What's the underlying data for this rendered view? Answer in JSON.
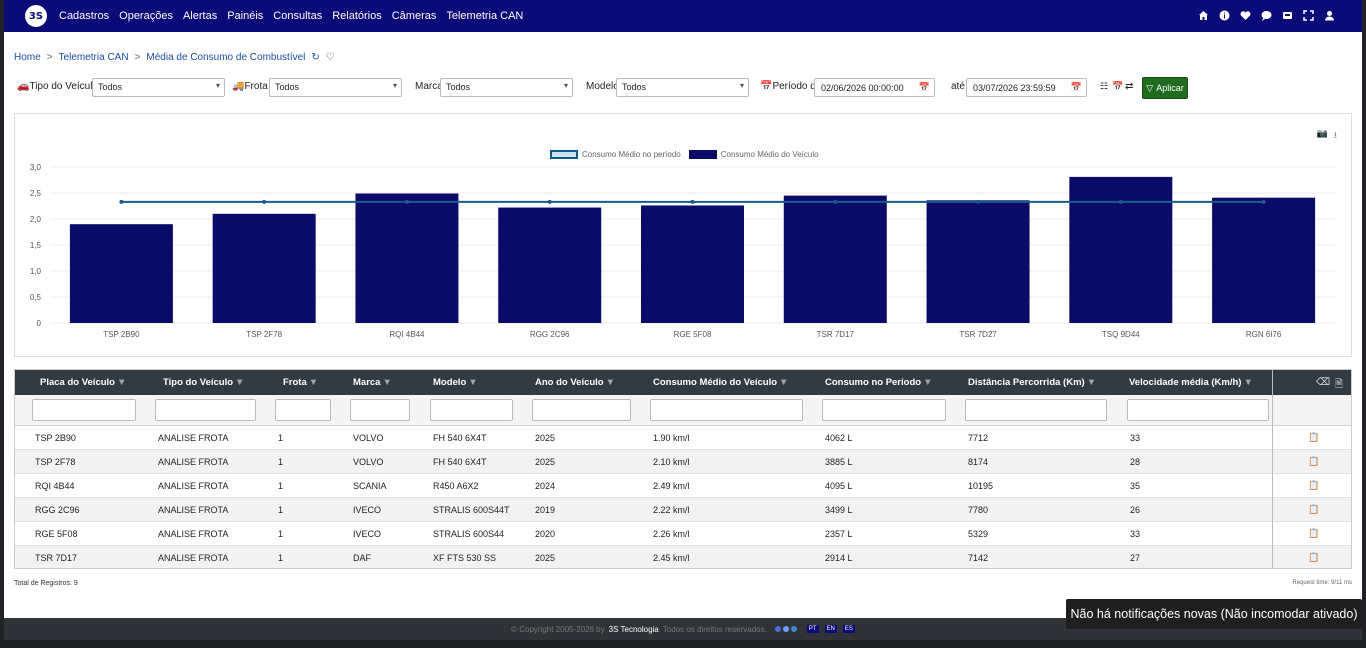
{
  "nav": {
    "menu": [
      "Cadastros",
      "Operações",
      "Alertas",
      "Painéis",
      "Consultas",
      "Relatórios",
      "Câmeras",
      "Telemetria CAN"
    ],
    "icons": [
      "home-icon",
      "info-icon",
      "heart-icon",
      "chat-icon",
      "inbox-icon",
      "fullscreen-icon",
      "user-icon"
    ]
  },
  "breadcrumb": {
    "home": "Home",
    "section": "Telemetria CAN",
    "page": "Média de Consumo de Combustível"
  },
  "filters": {
    "tipo_label": "Tipo do Veículo",
    "tipo_value": "Todos",
    "frota_label": "Frota",
    "frota_value": "Todos",
    "marca_label": "Marca",
    "marca_value": "Todos",
    "modelo_label": "Modelo",
    "modelo_value": "Todos",
    "periodo_label": "Período de",
    "periodo_start": "02/06/2026 00:00:00",
    "ate_label": "até",
    "periodo_end": "03/07/2026 23:59:59",
    "apply_label": "Aplicar"
  },
  "chart_data": {
    "type": "bar",
    "categories": [
      "TSP 2B90",
      "TSP 2F78",
      "RQI 4B44",
      "RGG 2C96",
      "RGE 5F08",
      "TSR 7D17",
      "TSR 7D27",
      "TSQ 9D44",
      "RGN 6I76"
    ],
    "series": [
      {
        "name": "Consumo Médio do Veículo",
        "type": "bar",
        "values": [
          1.9,
          2.1,
          2.49,
          2.22,
          2.26,
          2.45,
          2.36,
          2.81,
          2.41
        ],
        "color": "#0a0a68"
      },
      {
        "name": "Consumo Médio no período",
        "type": "line",
        "values": [
          2.33,
          2.33,
          2.33,
          2.33,
          2.33,
          2.33,
          2.33,
          2.33,
          2.33
        ],
        "color": "#1a5a8c"
      }
    ],
    "yticks": [
      "0",
      "0,5",
      "1,0",
      "1,5",
      "2,0",
      "2,5",
      "3,0"
    ],
    "ylim": [
      0,
      3
    ],
    "legend_position": "top-center",
    "grid": true
  },
  "table": {
    "headers": [
      "Placa do Veículo",
      "Tipo do Veículo",
      "Frota",
      "Marca",
      "Modelo",
      "Ano do Veículo",
      "Consumo Médio do Veículo",
      "Consumo no Período",
      "Distância Percorrida (Km)",
      "Velocidade média (Km/h)"
    ],
    "rows": [
      [
        "TSP 2B90",
        "ANALISE FROTA",
        "1",
        "VOLVO",
        "FH 540 6X4T",
        "2025",
        "1.90 km/l",
        "4062 L",
        "7712",
        "33"
      ],
      [
        "TSP 2F78",
        "ANALISE FROTA",
        "1",
        "VOLVO",
        "FH 540 6X4T",
        "2025",
        "2.10 km/l",
        "3885 L",
        "8174",
        "28"
      ],
      [
        "RQI 4B44",
        "ANALISE FROTA",
        "1",
        "SCANIA",
        "R450 A6X2",
        "2024",
        "2.49 km/l",
        "4095 L",
        "10195",
        "35"
      ],
      [
        "RGG 2C96",
        "ANALISE FROTA",
        "1",
        "IVECO",
        "STRALIS 600S44T",
        "2019",
        "2.22 km/l",
        "3499 L",
        "7780",
        "26"
      ],
      [
        "RGE 5F08",
        "ANALISE FROTA",
        "1",
        "IVECO",
        "STRALIS 600S44",
        "2020",
        "2.26 km/l",
        "2357 L",
        "5329",
        "33"
      ],
      [
        "TSR 7D17",
        "ANALISE FROTA",
        "1",
        "DAF",
        "XF FTS 530 SS",
        "2025",
        "2.45 km/l",
        "2914 L",
        "7142",
        "27"
      ]
    ]
  },
  "total_registros": "Total de Registros: 9",
  "request_time": "Request time: 9/11 ms",
  "footer": {
    "copyright": "© Copyright 2005-2026 by",
    "company": "3S Tecnologia",
    "rights": "Todos os direitos reservados.",
    "langs": [
      "PT",
      "EN",
      "ES"
    ]
  },
  "toast": "Não há notificações novas (Não incomodar ativado)"
}
